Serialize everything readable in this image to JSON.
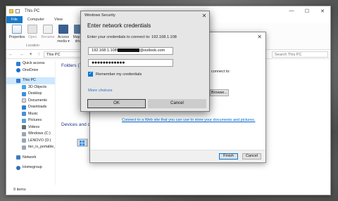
{
  "explorer": {
    "title": "This PC",
    "window_controls": [
      "—",
      "☐",
      "✕"
    ],
    "ribbon_tabs": [
      "File",
      "Computer",
      "View"
    ],
    "ribbon_buttons": [
      {
        "label": "Properties"
      },
      {
        "label": "Open"
      },
      {
        "label": "Rename"
      },
      {
        "label": "Access media ▾"
      },
      {
        "label": "Map ne drive"
      }
    ],
    "ribbon_group": "Location",
    "nav_arrows": "← → ▾ ↑",
    "address": "This PC",
    "search_placeholder": "Search This PC",
    "nav": {
      "quick_access": "Quick access",
      "onedrive": "OneDrive",
      "this_pc": "This PC",
      "items": [
        "3D Objects",
        "Desktop",
        "Documents",
        "Downloads",
        "Music",
        "Pictures",
        "Videos",
        "Windows (C:)",
        "LENOVO (D:)",
        "tier_iv_portable_("
      ],
      "network": "Network",
      "homegroup": "Homegroup"
    },
    "section_folders": "Folders (7",
    "section_devices": "Devices and dri",
    "status": "9 items"
  },
  "wizard": {
    "close_glyph": "✕",
    "connect_text": "connect to:",
    "browse_label": "Browse...",
    "link_text": "Connect to a Web site that you can use to store your documents and pictures.",
    "finish_label": "Finish",
    "cancel_label": "Cancel"
  },
  "credentials": {
    "window_title": "Windows Security",
    "close_glyph": "✕",
    "heading": "Enter network credentials",
    "subtitle": "Enter your credentials to connect to: 192.168.1.108",
    "username_prefix": "192.168.1.108\\",
    "username_suffix": "@outlook.com",
    "password_mask": "●●●●●●●●●●●●",
    "remember_label": "Remember my credentials",
    "remember_checked": true,
    "more_choices": "More choices",
    "ok_label": "OK",
    "cancel_label": "Cancel"
  },
  "colors": {
    "accent": "#0078d7",
    "file_tab": "#1979ca",
    "link": "#0066cc"
  }
}
